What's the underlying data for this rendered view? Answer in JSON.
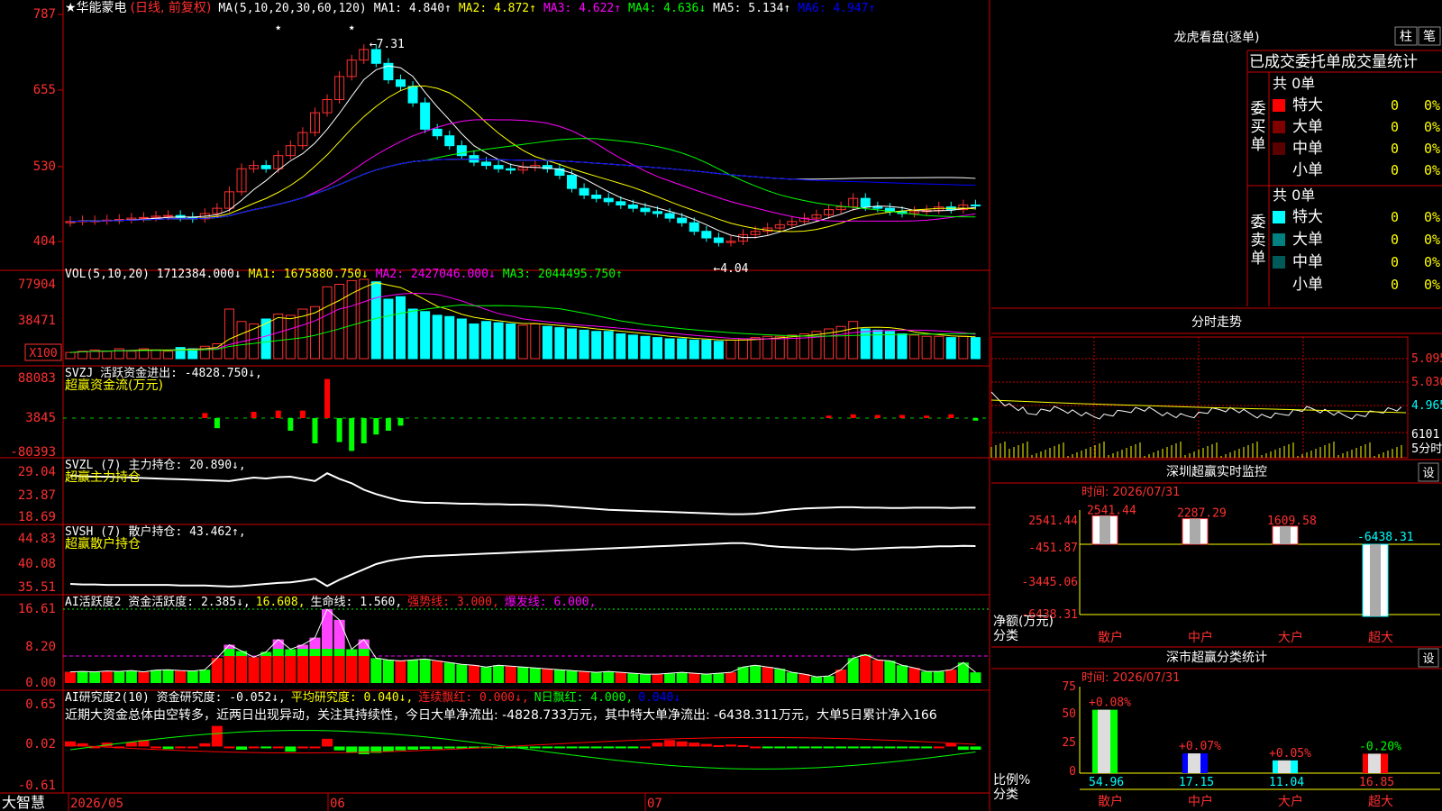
{
  "app": {
    "brand": "大智慧"
  },
  "stock": {
    "name": "华能蒙电",
    "mode": "(日线, 前复权)"
  },
  "main_panel": {
    "ma_prefix": "MA(5,10,20,30,60,120)",
    "ma_items": [
      {
        "label": "MA1: 4.840↑",
        "color": "#ffffff"
      },
      {
        "label": "MA2: 4.872↑",
        "color": "#ffff00"
      },
      {
        "label": "MA3: 4.622↑",
        "color": "#ff00ff"
      },
      {
        "label": "MA4: 4.636↓",
        "color": "#00ff00"
      },
      {
        "label": "MA5: 5.134↑",
        "color": "#ffffff"
      },
      {
        "label": "MA6: 4.947↑",
        "color": "#0000ff"
      }
    ],
    "axis_labels": [
      "787",
      "655",
      "530",
      "404"
    ],
    "high_annotation": "7.31",
    "low_annotation": "4.04",
    "stars": [
      "★",
      "★"
    ]
  },
  "vol_panel": {
    "header": "VOL(5,10,20) 1712384.000↓",
    "ma_items": [
      {
        "label": "MA1: 1675880.750↓",
        "color": "#ffff00"
      },
      {
        "label": "MA2: 2427046.000↓",
        "color": "#ff00ff"
      },
      {
        "label": "MA3: 2044495.750↑",
        "color": "#00ff00"
      }
    ],
    "axis_labels": [
      "77904",
      "38471"
    ],
    "unit": "X100"
  },
  "svzj_panel": {
    "title": "SVZJ  活跃资金进出: -4828.750↓,",
    "subtitle": "超赢资金流(万元)",
    "axis_labels": [
      "88083",
      "3845",
      "-80393"
    ]
  },
  "svzl_panel": {
    "title": "SVZL (7) 主力持仓: 20.890↓,",
    "subtitle": "超赢主力持仓",
    "axis_labels": [
      "29.04",
      "23.87",
      "18.69"
    ]
  },
  "svsh_panel": {
    "title": "SVSH (7) 散户持仓: 43.462↑,",
    "subtitle": "超赢散户持仓",
    "axis_labels": [
      "44.83",
      "40.08",
      "35.51"
    ]
  },
  "ai_active_panel": {
    "title_parts": [
      {
        "text": "AI活跃度2 资金活跃度: 2.385↓,",
        "color": "#ffffff"
      },
      {
        "text": "16.608,",
        "color": "#ffff00"
      },
      {
        "text": "生命线: 1.560,",
        "color": "#ffffff"
      },
      {
        "text": "强势线: 3.000,",
        "color": "#ff2222"
      },
      {
        "text": "爆发线: 6.000,",
        "color": "#ff00ff"
      }
    ],
    "axis_labels": [
      "16.61",
      "8.20",
      "0.00"
    ]
  },
  "ai_research_panel": {
    "title_parts": [
      {
        "text": "AI研究度2(10) 资金研究度: -0.052↓,",
        "color": "#ffffff"
      },
      {
        "text": "平均研究度: 0.040↓,",
        "color": "#ffff00"
      },
      {
        "text": "连续飘红: 0.000↓,",
        "color": "#ff2222"
      },
      {
        "text": "N日飘红: 4.000,",
        "color": "#00ff00"
      },
      {
        "text": "0.040↓",
        "color": "#0000ff"
      }
    ],
    "comment": "近期大资金总体由空转多，近两日出现异动，关注其持续性，今日大单净流出: -4828.733万元，其中特大单净流出: -6438.311万元，大单5日累计净入166",
    "axis_labels": [
      "0.65",
      "0.02",
      "-0.61"
    ]
  },
  "date_axis": [
    "2026/05",
    "06",
    "07"
  ],
  "right_panel": {
    "longhu": {
      "title": "龙虎看盘(逐单)",
      "buttons": [
        "柱",
        "笔"
      ],
      "table_title": "已成交委托单成交量统计",
      "buy_label": "委买单",
      "sell_label": "委卖单",
      "buy_total": "共 0单",
      "sell_total": "共 0单",
      "buy_rows": [
        {
          "label": "特大",
          "count": "0",
          "pct": "0%",
          "color": "#ff0000"
        },
        {
          "label": "大单",
          "count": "0",
          "pct": "0%",
          "color": "#800000"
        },
        {
          "label": "中单",
          "count": "0",
          "pct": "0%",
          "color": "#5a0000"
        },
        {
          "label": "小单",
          "count": "0",
          "pct": "0%",
          "color": "#000000"
        }
      ],
      "sell_rows": [
        {
          "label": "特大",
          "count": "0",
          "pct": "0%",
          "color": "#00ffff"
        },
        {
          "label": "大单",
          "count": "0",
          "pct": "0%",
          "color": "#008080"
        },
        {
          "label": "中单",
          "count": "0",
          "pct": "0%",
          "color": "#005a5a"
        },
        {
          "label": "小单",
          "count": "0",
          "pct": "0%",
          "color": "#000000"
        }
      ]
    },
    "intraday": {
      "title": "分时走势",
      "price_labels": [
        "5.095",
        "5.030",
        "4.965"
      ],
      "vol_label": "6101",
      "unit": "5分时"
    },
    "sz_monitor": {
      "title": "深圳超赢实时监控",
      "set_button": "设",
      "time": "时间: 2026/07/31",
      "axis_labels": [
        "2541.44",
        "-451.87",
        "-3445.06",
        "-6438.31"
      ],
      "ylabel": "净额(万元)",
      "xlabel": "分类",
      "categories": [
        "散户",
        "中户",
        "大户",
        "超大"
      ],
      "values": [
        "2541.44",
        "2287.29",
        "1609.58",
        "-6438.31"
      ]
    },
    "sz_class": {
      "title": "深市超赢分类统计",
      "set_button": "设",
      "time": "时间: 2026/07/31",
      "axis_labels": [
        "75",
        "50",
        "25",
        "0"
      ],
      "ylabel": "比例%",
      "xlabel": "分类",
      "categories": [
        "散户",
        "中户",
        "大户",
        "超大"
      ],
      "values": [
        "54.96",
        "17.15",
        "11.04",
        "16.85"
      ],
      "changes": [
        "+0.08%",
        "+0.07%",
        "+0.05%",
        "-0.20%"
      ]
    }
  },
  "chart_data": [
    {
      "type": "candlestick",
      "title": "华能蒙电",
      "x_range": [
        "2026/05",
        "2026/07"
      ],
      "ylim": [
        4.04,
        7.87
      ],
      "high": 7.31,
      "low": 4.04,
      "close_series": [
        4.7,
        4.71,
        4.71,
        4.72,
        4.73,
        4.75,
        4.76,
        4.78,
        4.79,
        4.76,
        4.74,
        4.82,
        4.9,
        5.15,
        5.5,
        5.55,
        5.5,
        5.7,
        5.85,
        6.05,
        6.35,
        6.55,
        6.9,
        7.15,
        7.31,
        7.1,
        6.85,
        6.75,
        6.5,
        6.1,
        6.0,
        5.85,
        5.7,
        5.6,
        5.55,
        5.5,
        5.48,
        5.52,
        5.55,
        5.5,
        5.4,
        5.2,
        5.1,
        5.05,
        5.0,
        4.95,
        4.9,
        4.85,
        4.82,
        4.75,
        4.68,
        4.55,
        4.45,
        4.38,
        4.4,
        4.5,
        4.55,
        4.6,
        4.65,
        4.7,
        4.75,
        4.8,
        4.88,
        4.92,
        5.05,
        4.92,
        4.9,
        4.85,
        4.82,
        4.85,
        4.87,
        4.92,
        4.88,
        4.95,
        4.94
      ]
    },
    {
      "type": "bar",
      "title": "VOL(5,10,20)",
      "unit": "X100",
      "values": [
        5,
        6,
        7,
        6,
        8,
        6,
        8,
        7,
        6,
        9,
        8,
        10,
        12,
        40,
        30,
        28,
        32,
        36,
        35,
        40,
        42,
        58,
        60,
        63,
        64,
        62,
        48,
        50,
        40,
        38,
        35,
        34,
        32,
        28,
        30,
        29,
        28,
        27,
        28,
        26,
        25,
        24,
        23,
        22,
        22,
        20,
        19,
        18,
        17,
        16,
        16,
        15,
        15,
        14,
        15,
        16,
        17,
        18,
        18,
        19,
        20,
        22,
        24,
        26,
        30,
        24,
        23,
        22,
        20,
        19,
        18,
        18,
        17,
        18,
        17
      ]
    },
    {
      "type": "bar",
      "title": "SVZJ 活跃资金进出",
      "values": [
        0,
        0,
        0,
        0,
        0,
        0,
        0,
        0,
        0,
        0,
        0,
        8,
        -16,
        0,
        0,
        10,
        0,
        12,
        -20,
        12,
        -40,
        62,
        -38,
        -52,
        -40,
        -26,
        -20,
        -12,
        0,
        0,
        0,
        0,
        0,
        0,
        0,
        0,
        0,
        0,
        0,
        0,
        0,
        0,
        0,
        0,
        0,
        0,
        0,
        0,
        0,
        0,
        0,
        0,
        0,
        0,
        0,
        0,
        0,
        0,
        0,
        0,
        0,
        0,
        4,
        0,
        6,
        0,
        5,
        0,
        5,
        0,
        4,
        0,
        6,
        0,
        -4
      ]
    },
    {
      "type": "line",
      "title": "SVZL (7) 主力持仓",
      "ylim": [
        18.69,
        29.04
      ],
      "values": [
        28.2,
        28.1,
        28.0,
        28.0,
        27.9,
        27.8,
        27.7,
        27.6,
        27.5,
        27.4,
        27.3,
        27.2,
        27.1,
        27.0,
        27.4,
        27.8,
        27.6,
        27.9,
        28.0,
        27.5,
        27.0,
        28.8,
        27.5,
        26.5,
        25.0,
        24.0,
        23.2,
        22.5,
        22.2,
        22.0,
        22.0,
        21.9,
        21.8,
        21.8,
        21.7,
        21.7,
        21.6,
        21.6,
        21.5,
        21.4,
        21.2,
        21.0,
        20.8,
        20.6,
        20.4,
        20.3,
        20.2,
        20.1,
        20.0,
        19.9,
        19.8,
        19.7,
        19.6,
        19.5,
        19.4,
        19.4,
        19.5,
        19.8,
        20.2,
        20.5,
        20.7,
        20.8,
        20.9,
        21.0,
        21.0,
        20.9,
        20.9,
        20.8,
        20.8,
        20.9,
        20.9,
        20.9,
        20.8,
        20.9,
        20.9
      ]
    },
    {
      "type": "line",
      "title": "SVSH (7) 散户持仓",
      "ylim": [
        35.51,
        44.83
      ],
      "values": [
        36.2,
        36.1,
        36.1,
        36.0,
        36.0,
        36.0,
        36.0,
        36.0,
        36.0,
        35.9,
        35.9,
        35.9,
        35.8,
        35.7,
        35.8,
        36.0,
        36.2,
        36.4,
        36.5,
        36.8,
        37.2,
        35.8,
        37.0,
        38.0,
        39.0,
        40.0,
        40.6,
        41.0,
        41.3,
        41.5,
        41.6,
        41.7,
        41.8,
        41.9,
        42.0,
        42.1,
        42.2,
        42.3,
        42.4,
        42.5,
        42.6,
        42.7,
        42.8,
        42.9,
        43.0,
        43.1,
        43.2,
        43.3,
        43.4,
        43.5,
        43.6,
        43.7,
        43.8,
        43.9,
        44.0,
        44.0,
        43.8,
        43.5,
        43.3,
        43.2,
        43.1,
        43.0,
        43.0,
        42.9,
        42.8,
        42.9,
        43.0,
        43.1,
        43.2,
        43.2,
        43.3,
        43.4,
        43.4,
        43.5,
        43.46
      ]
    },
    {
      "type": "bar",
      "title": "AI活跃度2 资金活跃度",
      "ylim": [
        0,
        16.61
      ],
      "values": [
        2.5,
        2.6,
        2.5,
        2.7,
        2.6,
        2.8,
        2.5,
        2.9,
        3.0,
        2.8,
        2.7,
        3.0,
        5.6,
        8.6,
        7.2,
        5.8,
        7.0,
        9.8,
        7.6,
        8.6,
        10.2,
        16.6,
        14.2,
        7.6,
        9.8,
        5.6,
        5.2,
        5.0,
        5.2,
        5.4,
        5.0,
        4.6,
        4.2,
        4.0,
        3.6,
        4.0,
        3.8,
        3.6,
        3.4,
        3.2,
        3.0,
        2.8,
        2.6,
        2.4,
        2.6,
        2.4,
        2.2,
        2.0,
        2.0,
        2.2,
        2.4,
        2.2,
        2.0,
        2.2,
        2.4,
        3.6,
        4.0,
        3.6,
        3.2,
        2.4,
        2.0,
        1.4,
        1.6,
        3.0,
        5.6,
        6.4,
        5.2,
        5.0,
        4.0,
        3.4,
        2.6,
        2.6,
        3.0,
        4.6,
        2.4
      ]
    },
    {
      "type": "bar",
      "title": "AI研究度2(10) 资金研究度",
      "ylim": [
        -0.61,
        0.65
      ],
      "values": [
        0.08,
        0.05,
        0.0,
        0.06,
        0.0,
        0.07,
        0.1,
        0.0,
        -0.04,
        0.0,
        0.0,
        0.05,
        0.32,
        0.0,
        -0.05,
        0.0,
        -0.02,
        0.0,
        -0.08,
        0.0,
        0.0,
        0.12,
        -0.06,
        -0.1,
        -0.12,
        -0.1,
        -0.08,
        -0.06,
        -0.05,
        -0.04,
        -0.04,
        -0.03,
        -0.03,
        -0.03,
        -0.02,
        -0.02,
        -0.02,
        -0.02,
        -0.02,
        -0.02,
        -0.02,
        -0.02,
        -0.02,
        -0.02,
        -0.02,
        -0.02,
        -0.02,
        0.0,
        0.06,
        0.1,
        0.08,
        0.06,
        0.04,
        0.02,
        0.03,
        0.02,
        0.0,
        -0.02,
        -0.02,
        -0.02,
        -0.02,
        -0.02,
        -0.02,
        -0.02,
        -0.02,
        -0.02,
        -0.02,
        -0.02,
        -0.02,
        -0.02,
        -0.02,
        0.0,
        0.05,
        -0.052,
        -0.05
      ]
    }
  ]
}
